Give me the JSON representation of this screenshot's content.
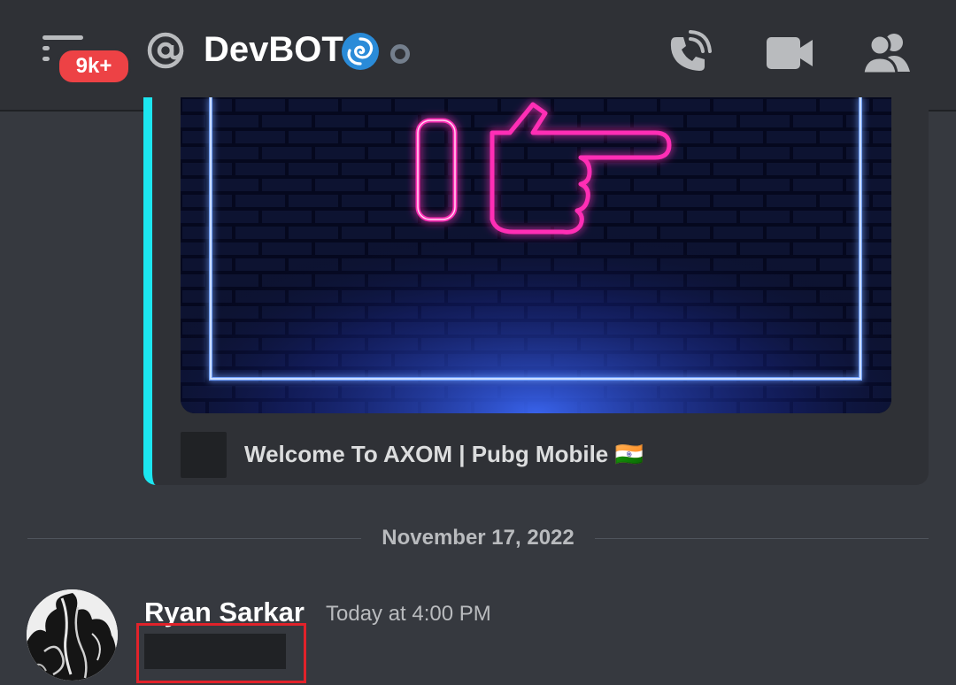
{
  "header": {
    "badge_count": "9k+",
    "channel_name": "DevBOT",
    "status": "offline",
    "icons": {
      "menu": "hamburger-menu-icon",
      "at": "at-sign-icon",
      "call": "phone-call-icon",
      "video": "video-camera-icon",
      "members": "members-icon"
    }
  },
  "embed": {
    "accent_color": "#1ce6f0",
    "footer_text": "Welcome To AXOM | Pubg Mobile 🇮🇳"
  },
  "divider": {
    "date": "November 17, 2022"
  },
  "message": {
    "username": "Ryan Sarkar",
    "timestamp": "Today at 4:00 PM"
  },
  "colors": {
    "background": "#36393f",
    "header": "#2f3136",
    "badge": "#ed4245",
    "highlight": "#e1222a",
    "neon_pink": "#ff2fb5",
    "neon_blue": "#2a6bff"
  }
}
